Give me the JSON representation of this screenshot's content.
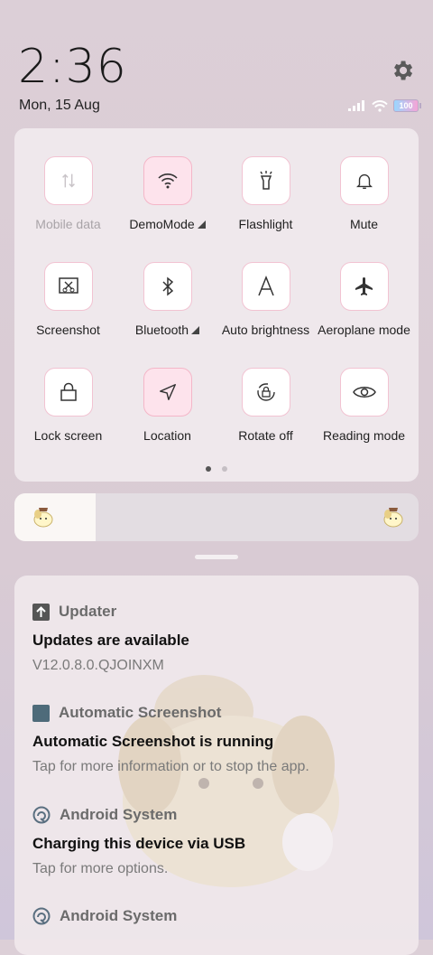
{
  "status": {
    "time": "2:36",
    "date": "Mon, 15 Aug",
    "battery": "100"
  },
  "quick_settings": {
    "tiles": [
      {
        "label": "Mobile data",
        "icon": "mobile-data-icon",
        "state": "disabled"
      },
      {
        "label": "DemoMode",
        "icon": "wifi-icon",
        "state": "on",
        "expandable": true
      },
      {
        "label": "Flashlight",
        "icon": "flashlight-icon",
        "state": "off"
      },
      {
        "label": "Mute",
        "icon": "bell-icon",
        "state": "off"
      },
      {
        "label": "Screenshot",
        "icon": "screenshot-icon",
        "state": "off"
      },
      {
        "label": "Bluetooth",
        "icon": "bluetooth-icon",
        "state": "off",
        "expandable": true
      },
      {
        "label": "Auto brightness",
        "icon": "auto-brightness-icon",
        "state": "off"
      },
      {
        "label": "Aeroplane mode",
        "icon": "airplane-icon",
        "state": "off"
      },
      {
        "label": "Lock screen",
        "icon": "lock-icon",
        "state": "off"
      },
      {
        "label": "Location",
        "icon": "location-icon",
        "state": "on"
      },
      {
        "label": "Rotate off",
        "icon": "rotate-lock-icon",
        "state": "off"
      },
      {
        "label": "Reading mode",
        "icon": "eye-icon",
        "state": "off"
      }
    ],
    "page_count": 2,
    "current_page": 1
  },
  "brightness": {
    "level": 0.2
  },
  "notifications": [
    {
      "app": "Updater",
      "icon": "upload-icon",
      "title": "Updates are available",
      "text": "V12.0.8.0.QJOINXM"
    },
    {
      "app": "Automatic Screenshot",
      "icon": "app-square-icon",
      "title": "Automatic Screenshot is running",
      "text": "Tap for more information or to stop the app."
    },
    {
      "app": "Android System",
      "icon": "android-system-icon",
      "title": "Charging this device via USB",
      "text": "Tap for more options."
    },
    {
      "app": "Android System",
      "icon": "android-system-icon",
      "title": "",
      "text": ""
    }
  ],
  "colors": {
    "accent_pink": "#fde3ec",
    "tile_border": "#f2c3d2",
    "background": "#dccfd7"
  }
}
